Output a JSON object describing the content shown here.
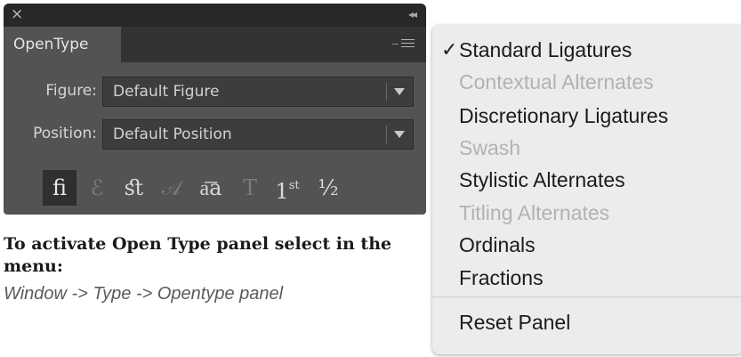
{
  "panel": {
    "tab_label": "OpenType",
    "close_glyph": "×",
    "collapse_glyph": "◂◂",
    "figure": {
      "label": "Figure:",
      "value": "Default Figure"
    },
    "position": {
      "label": "Position:",
      "value": "Default Position"
    },
    "glyph_buttons": [
      {
        "name": "standard-ligatures-button",
        "glyph": "ﬁ",
        "state": "active"
      },
      {
        "name": "contextual-alternates-button",
        "glyph": "ℰ",
        "state": "off"
      },
      {
        "name": "discretionary-ligatures-button",
        "glyph": "ﬆ",
        "state": "on"
      },
      {
        "name": "swash-button",
        "glyph": "𝒜",
        "state": "off"
      },
      {
        "name": "stylistic-alternates-button",
        "glyph": "a͞a",
        "state": "on"
      },
      {
        "name": "titling-alternates-button",
        "glyph": "T",
        "state": "off"
      },
      {
        "name": "ordinals-button",
        "glyph": "1",
        "sup": "st",
        "state": "on"
      },
      {
        "name": "fractions-button",
        "glyph": "½",
        "state": "on"
      }
    ]
  },
  "caption": {
    "title": "To activate Open Type panel select in the menu:",
    "path": "Window -> Type -> Opentype panel"
  },
  "menu": {
    "check_glyph": "✓",
    "items": [
      {
        "label": "Standard Ligatures",
        "enabled": true,
        "checked": true
      },
      {
        "label": "Contextual Alternates",
        "enabled": false,
        "checked": false
      },
      {
        "label": "Discretionary Ligatures",
        "enabled": true,
        "checked": false
      },
      {
        "label": "Swash",
        "enabled": false,
        "checked": false
      },
      {
        "label": "Stylistic Alternates",
        "enabled": true,
        "checked": false
      },
      {
        "label": "Titling Alternates",
        "enabled": false,
        "checked": false
      },
      {
        "label": "Ordinals",
        "enabled": true,
        "checked": false
      },
      {
        "label": "Fractions",
        "enabled": true,
        "checked": false
      },
      {
        "label": "Reset Panel",
        "enabled": true,
        "checked": false
      }
    ]
  }
}
